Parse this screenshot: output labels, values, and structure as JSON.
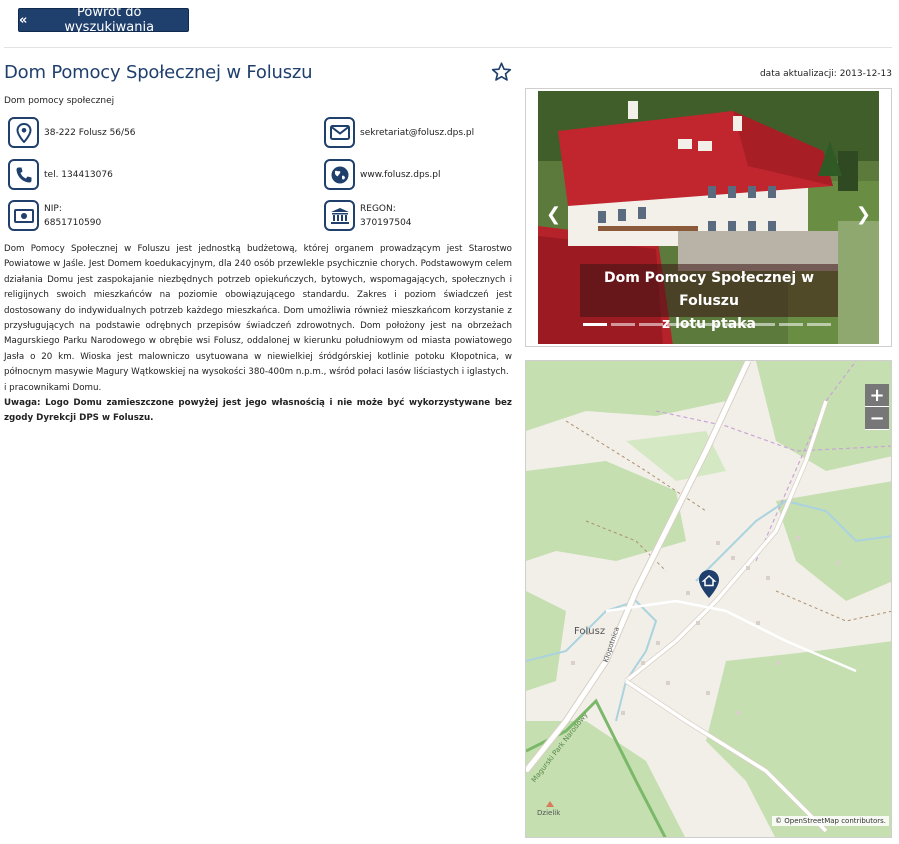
{
  "back_button": {
    "label": "Powrót do wyszukiwania",
    "icon": "double-chevron-left-icon"
  },
  "header": {
    "title": "Dom Pomocy Społecznej w Foluszu",
    "subtitle": "Dom pomocy społecznej",
    "updated_label": "data aktualizacji:",
    "updated_date": "2013-12-13"
  },
  "contacts": {
    "address": "38-222 Folusz 56/56",
    "email": "sekretariat@folusz.dps.pl",
    "phone": "tel. 134413076",
    "website": "www.folusz.dps.pl",
    "nip_label": "NIP:",
    "nip_value": "6851710590",
    "regon_label": "REGON:",
    "regon_value": "370197504"
  },
  "description": {
    "paragraph": "Dom Pomocy Społecznej w Foluszu jest jednostką budżetową, której organem prowadzącym jest Starostwo Powiatowe w Jaśle. Jest Domem koedukacyjnym, dla 240 osób przewlekle psychicznie chorych. Podstawowym celem działania Domu jest zaspokajanie niezbędnych potrzeb opiekuńczych, bytowych, wspomagających, społecznych i religijnych swoich mieszkańców na poziomie obowiązującego standardu. Zakres i poziom świadczeń jest dostosowany do indywidualnych potrzeb każdego mieszkańca. Dom umożliwia również mieszkańcom korzystanie z przysługujących na podstawie odrębnych przepisów świadczeń zdrowotnych. Dom położony jest na obrzeżach Magurskiego Parku Narodowego w obrębie wsi Folusz, oddalonej w kierunku południowym od miasta powiatowego Jasła o 20 km. Wioska jest malowniczo usytuowana w niewielkiej śródgórskiej kotlinie potoku Kłopotnica, w północnym masywie Magury Wątkowskiej na wysokości 380-400m n.p.m., wśród połaci lasów liściastych i iglastych.",
    "extra_line": "i pracownikami Domu.",
    "note": "Uwaga: Logo Domu zamieszczone powyżej jest jego własnością i nie może być wykorzystywane bez zgody Dyrekcji DPS w Foluszu."
  },
  "carousel": {
    "caption_line1": "Dom Pomocy Społecznej w Foluszu",
    "caption_line2": "z lotu ptaka",
    "prev_icon": "chevron-left-icon",
    "next_icon": "chevron-right-icon",
    "slide_count": 9,
    "active_slide": 1
  },
  "map": {
    "zoom_in": "+",
    "zoom_out": "−",
    "place_label": "Folusz",
    "stream_label": "Kłopotnica",
    "park_label": "Magurski Park Narodowy",
    "peak_label": "Dzielik",
    "attribution": "© OpenStreetMap contributors.",
    "marker_icon": "home-marker-icon"
  },
  "colors": {
    "primary": "#1f3f6c",
    "forest": "#b8d9a4",
    "road": "#ffffff"
  }
}
